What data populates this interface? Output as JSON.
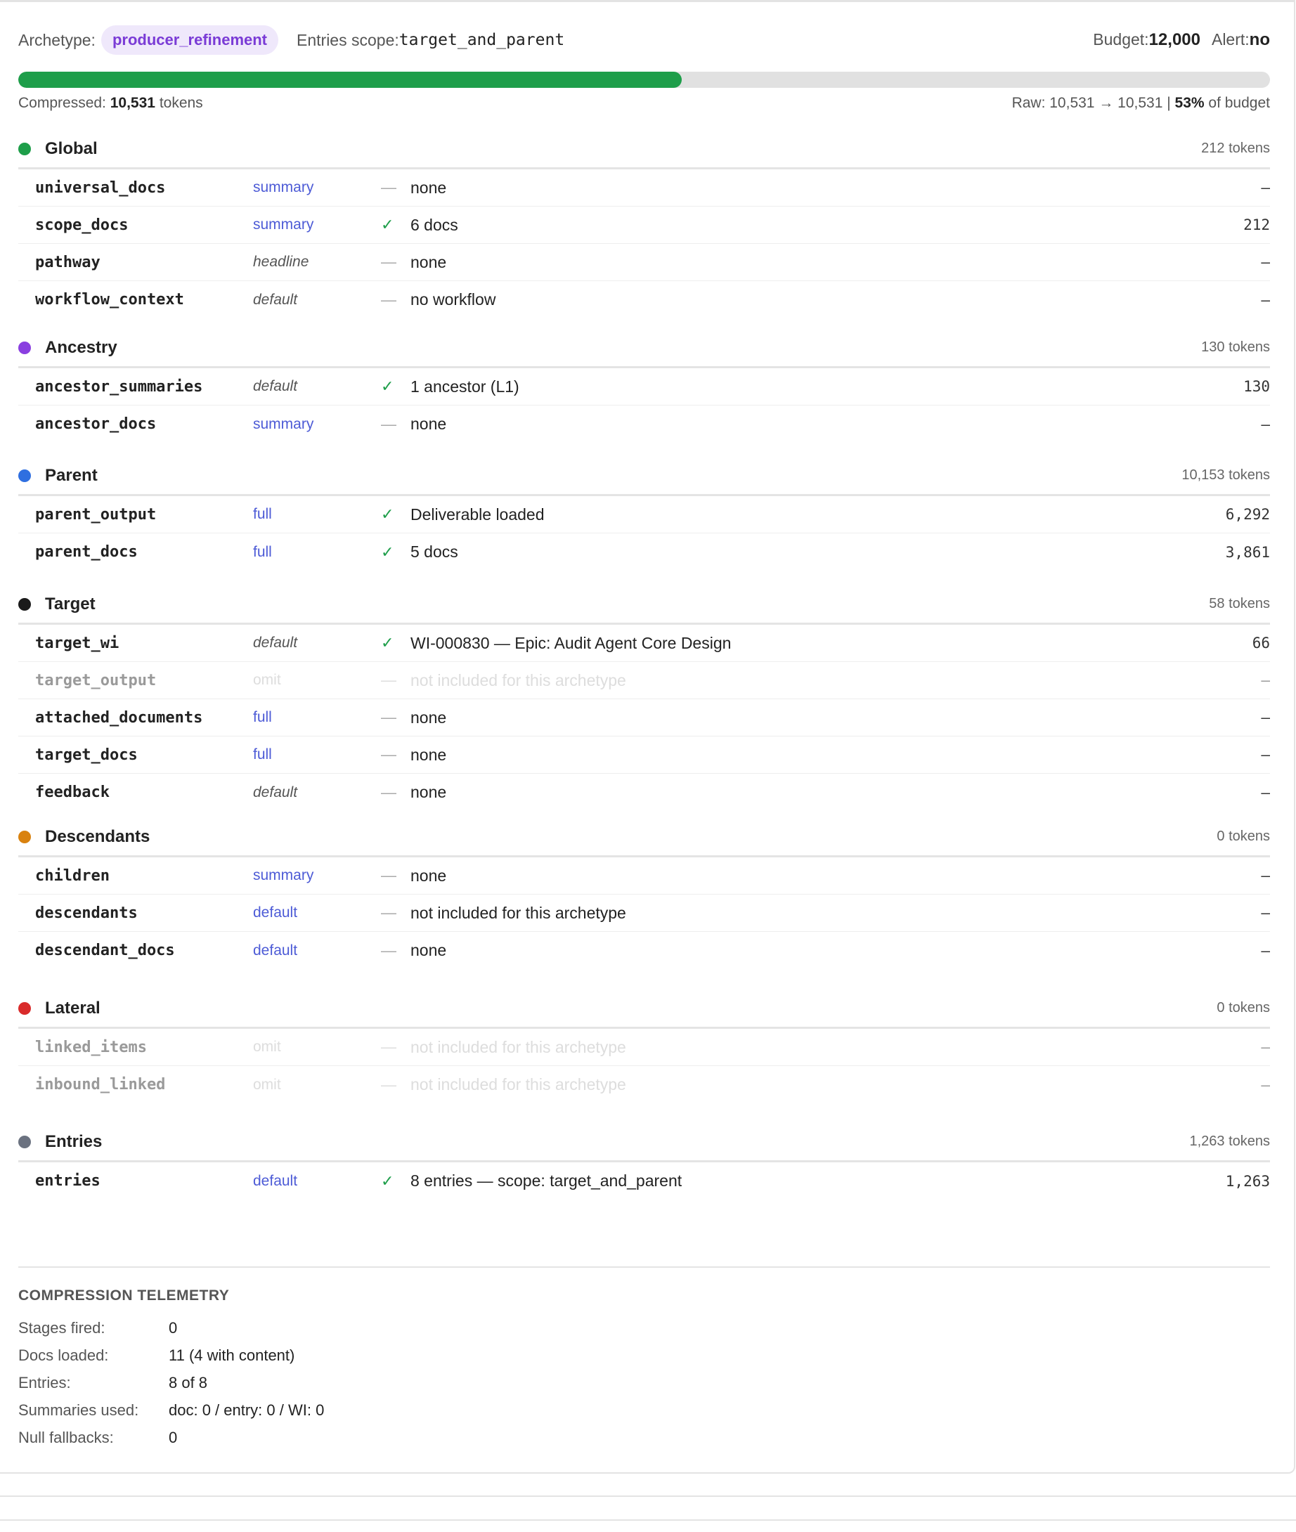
{
  "header": {
    "archetype_label": "Archetype:",
    "archetype_value": "producer_refinement",
    "scope_label": "Entries scope:",
    "scope_value": "target_and_parent",
    "budget_label": "Budget:",
    "budget_value": "12,000",
    "alert_label": "Alert:",
    "alert_value": "no"
  },
  "progress": {
    "percent": 53,
    "color": "#1e9e4a"
  },
  "meta": {
    "compressed_label": "Compressed:",
    "compressed_value": "10,531",
    "compressed_unit": "tokens",
    "raw_prefix": "Raw: 10,531 → 10,531 |",
    "raw_pct": "53%",
    "raw_suffix": "of budget"
  },
  "sections": [
    {
      "title": "Global",
      "tokens": "212 tokens",
      "color": "#1e9e4a",
      "rows": [
        {
          "name": "universal_docs",
          "mode": "summary",
          "mode_style": "summary",
          "mark": "—",
          "mark_style": "dash",
          "desc": "none",
          "tokens": "–"
        },
        {
          "name": "scope_docs",
          "mode": "summary",
          "mode_style": "summary",
          "mark": "✓",
          "mark_style": "check",
          "desc": "6 docs",
          "tokens": "212"
        },
        {
          "name": "pathway",
          "mode": "headline",
          "mode_style": "headline",
          "mark": "—",
          "mark_style": "dash",
          "desc": "none",
          "tokens": "–"
        },
        {
          "name": "workflow_context",
          "mode": "default",
          "mode_style": "default-italic",
          "mark": "—",
          "mark_style": "dash",
          "desc": "no workflow",
          "tokens": "–"
        }
      ]
    },
    {
      "title": "Ancestry",
      "tokens": "130 tokens",
      "color": "#8a3fe0",
      "rows": [
        {
          "name": "ancestor_summaries",
          "mode": "default",
          "mode_style": "default-italic",
          "mark": "✓",
          "mark_style": "check",
          "desc": "1 ancestor (L1)",
          "tokens": "130"
        },
        {
          "name": "ancestor_docs",
          "mode": "summary",
          "mode_style": "summary",
          "mark": "—",
          "mark_style": "dash",
          "desc": "none",
          "tokens": "–"
        }
      ]
    },
    {
      "title": "Parent",
      "tokens": "10,153 tokens",
      "color": "#2f6fe0",
      "rows": [
        {
          "name": "parent_output",
          "mode": "full",
          "mode_style": "full",
          "mark": "✓",
          "mark_style": "check",
          "desc": "Deliverable loaded",
          "tokens": "6,292"
        },
        {
          "name": "parent_docs",
          "mode": "full",
          "mode_style": "full",
          "mark": "✓",
          "mark_style": "check",
          "desc": "5 docs",
          "tokens": "3,861"
        }
      ]
    },
    {
      "title": "Target",
      "tokens": "58 tokens",
      "color": "#1a1a1a",
      "rows": [
        {
          "name": "target_wi",
          "mode": "default",
          "mode_style": "default-italic",
          "mark": "✓",
          "mark_style": "check",
          "desc": "WI-000830 — Epic: Audit Agent Core Design",
          "tokens": "66"
        },
        {
          "name": "target_output",
          "mode": "omit",
          "mode_style": "omit",
          "mark": "—",
          "mark_style": "dash",
          "desc": "not included for this archetype",
          "tokens": "–",
          "omitted": true
        },
        {
          "name": "attached_documents",
          "mode": "full",
          "mode_style": "full",
          "mark": "—",
          "mark_style": "dash",
          "desc": "none",
          "tokens": "–"
        },
        {
          "name": "target_docs",
          "mode": "full",
          "mode_style": "full",
          "mark": "—",
          "mark_style": "dash",
          "desc": "none",
          "tokens": "–"
        },
        {
          "name": "feedback",
          "mode": "default",
          "mode_style": "default-italic",
          "mark": "—",
          "mark_style": "dash",
          "desc": "none",
          "tokens": "–"
        }
      ]
    },
    {
      "title": "Descendants",
      "tokens": "0 tokens",
      "color": "#d9820f",
      "rows": [
        {
          "name": "children",
          "mode": "summary",
          "mode_style": "summary",
          "mark": "—",
          "mark_style": "dash",
          "desc": "none",
          "tokens": "–"
        },
        {
          "name": "descendants",
          "mode": "default",
          "mode_style": "default-blue",
          "mark": "—",
          "mark_style": "dash",
          "desc": "not included for this archetype",
          "tokens": "–"
        },
        {
          "name": "descendant_docs",
          "mode": "default",
          "mode_style": "default-blue",
          "mark": "—",
          "mark_style": "dash",
          "desc": "none",
          "tokens": "–"
        }
      ]
    },
    {
      "title": "Lateral",
      "tokens": "0 tokens",
      "color": "#d92b2b",
      "rows": [
        {
          "name": "linked_items",
          "mode": "omit",
          "mode_style": "omit",
          "mark": "—",
          "mark_style": "dash",
          "desc": "not included for this archetype",
          "tokens": "–",
          "omitted": true
        },
        {
          "name": "inbound_linked",
          "mode": "omit",
          "mode_style": "omit",
          "mark": "—",
          "mark_style": "dash",
          "desc": "not included for this archetype",
          "tokens": "–",
          "omitted": true
        }
      ]
    },
    {
      "title": "Entries",
      "tokens": "1,263 tokens",
      "color": "#6b7280",
      "rows": [
        {
          "name": "entries",
          "mode": "default",
          "mode_style": "default-blue",
          "mark": "✓",
          "mark_style": "check",
          "desc": "8 entries — scope: target_and_parent",
          "tokens": "1,263"
        }
      ]
    }
  ],
  "telemetry": {
    "title": "COMPRESSION TELEMETRY",
    "rows": [
      {
        "label": "Stages fired:",
        "value": "0"
      },
      {
        "label": "Docs loaded:",
        "value": "11 (4 with content)"
      },
      {
        "label": "Entries:",
        "value": "8 of 8"
      },
      {
        "label": "Summaries used:",
        "value": "doc: 0 / entry: 0 / WI: 0"
      },
      {
        "label": "Null fallbacks:",
        "value": "0"
      }
    ]
  }
}
